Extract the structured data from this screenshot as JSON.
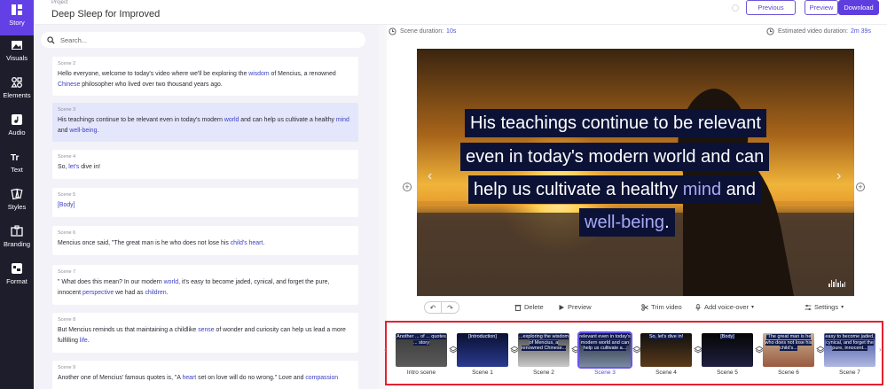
{
  "rail": [
    {
      "label": "Story",
      "icon": "story-icon",
      "active": true
    },
    {
      "label": "Visuals",
      "icon": "visuals-icon"
    },
    {
      "label": "Elements",
      "icon": "elements-icon"
    },
    {
      "label": "Audio",
      "icon": "audio-icon"
    },
    {
      "label": "Text",
      "icon": "text-icon"
    },
    {
      "label": "Styles",
      "icon": "styles-icon"
    },
    {
      "label": "Branding",
      "icon": "branding-icon"
    },
    {
      "label": "Format",
      "icon": "format-icon"
    }
  ],
  "header": {
    "project_label": "Project",
    "title": "Deep Sleep for Improved",
    "previous": "Previous",
    "preview": "Preview",
    "download": "Download"
  },
  "search": {
    "placeholder": "Search..."
  },
  "scenes": [
    {
      "num": "Scene 2",
      "text": "Hello everyone, welcome to today's video where we'll be exploring the wisdom of Mencius, a renowned Chinese philosopher who lived over two thousand years ago."
    },
    {
      "num": "Scene 3",
      "text": "His teachings continue to be relevant even in today's modern world and can help us cultivate a healthy mind and well-being."
    },
    {
      "num": "Scene 4",
      "text": "So, let's dive in!"
    },
    {
      "num": "Scene 5",
      "text": "[Body]"
    },
    {
      "num": "Scene 6",
      "text": "Mencius once said, \"The great man is he who does not lose his child's heart."
    },
    {
      "num": "Scene 7",
      "text": "\" What does this mean? In our modern world, it's easy to become jaded, cynical, and forget the pure, innocent perspective we had as children."
    },
    {
      "num": "Scene 8",
      "text": "But Mencius reminds us that maintaining a childlike sense of wonder and curiosity can help us lead a more fulfilling life."
    },
    {
      "num": "Scene 9",
      "text": "Another one of Mencius' famous quotes is, \"A heart set on love will do no wrong.\" Love and compassion"
    }
  ],
  "durations": {
    "scene_label": "Scene duration:",
    "scene_value": "10s",
    "estimated_label": "Estimated video duration:",
    "estimated_value": "2m 39s"
  },
  "caption": {
    "line1": "His teachings continue to be relevant",
    "line2": "even in today's modern world and can",
    "line3_a": "help us cultivate a healthy",
    "line3_b": "mind",
    "line3_c": "and",
    "line4_a": "well-being",
    "line4_b": "."
  },
  "toolbar": {
    "delete": "Delete",
    "preview": "Preview",
    "trim": "Trim video",
    "voice": "Add voice-over",
    "settings": "Settings"
  },
  "timeline": [
    {
      "label": "Intro scene",
      "text": "Another ... of ... quotes ... story"
    },
    {
      "label": "Scene 1",
      "text": "[Introduction]"
    },
    {
      "label": "Scene 2",
      "text": "...exploring the wisdom of Mencius, a renowned Chinese..."
    },
    {
      "label": "Scene 3",
      "text": "relevant even in today's modern world and can help us cultivate a...",
      "active": true
    },
    {
      "label": "Scene 4",
      "text": "So, let's dive in!"
    },
    {
      "label": "Scene 5",
      "text": "[Body]"
    },
    {
      "label": "Scene 6",
      "text": "\"The great man is he who does not lose his child's..."
    },
    {
      "label": "Scene 7",
      "text": "easy to become jaded, cynical, and forget the pure, innocent..."
    }
  ]
}
